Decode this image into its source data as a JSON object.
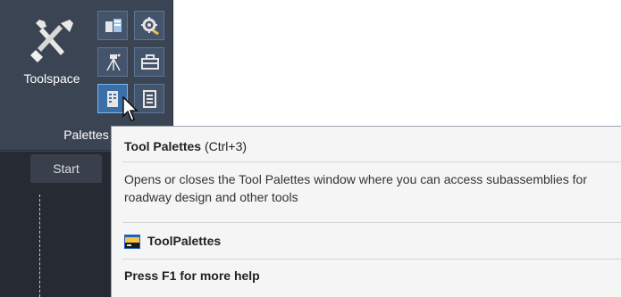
{
  "ribbon": {
    "toolspace_label": "Toolspace",
    "panel_label": "Palettes",
    "small_buttons": [
      {
        "name": "survey-database-button",
        "icon": "survey-database-icon"
      },
      {
        "name": "settings-button",
        "icon": "gear-icon"
      },
      {
        "name": "survey-button",
        "icon": "survey-instrument-icon"
      },
      {
        "name": "toolbox-button",
        "icon": "toolbox-icon"
      },
      {
        "name": "tool-palettes-button",
        "icon": "tool-palettes-icon"
      },
      {
        "name": "properties-button",
        "icon": "properties-icon"
      }
    ],
    "accent": "#3c6fa7"
  },
  "tabs": {
    "start_label": "Start"
  },
  "tooltip": {
    "title": "Tool Palettes",
    "shortcut": "(Ctrl+3)",
    "description": "Opens or closes the Tool Palettes window where you can access subassemblies for roadway design and other tools",
    "command_name": "ToolPalettes",
    "help_text": "Press F1 for more help"
  }
}
